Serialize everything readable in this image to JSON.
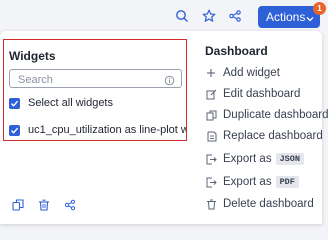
{
  "toolbar": {
    "actions_label": "Actions",
    "notification_count": "1",
    "icons": [
      "search-icon",
      "star-icon",
      "share-icon"
    ]
  },
  "widgets": {
    "title": "Widgets",
    "search_placeholder": "Search",
    "select_all_label": "Select all widgets",
    "items": [
      {
        "label": "uc1_cpu_utilization as line-plot wh...",
        "checked": true
      }
    ]
  },
  "dashboard_menu": {
    "title": "Dashboard",
    "items": [
      {
        "label": "Add widget",
        "icon": "plus-icon"
      },
      {
        "label": "Edit dashboard",
        "icon": "edit-icon"
      },
      {
        "label": "Duplicate dashboard",
        "icon": "copy-icon"
      },
      {
        "label": "Replace dashboard",
        "icon": "replace-icon"
      },
      {
        "label": "Export as",
        "badge": "JSON",
        "icon": "export-icon"
      },
      {
        "label": "Export as",
        "badge": "PDF",
        "icon": "export-icon"
      },
      {
        "label": "Delete dashboard",
        "icon": "trash-icon"
      }
    ]
  },
  "bottom_actions": [
    "copy-icon",
    "trash-icon",
    "share-icon"
  ],
  "colors": {
    "accent": "#2e60d8",
    "badge": "#e8652b",
    "highlight": "#d12b2b"
  }
}
